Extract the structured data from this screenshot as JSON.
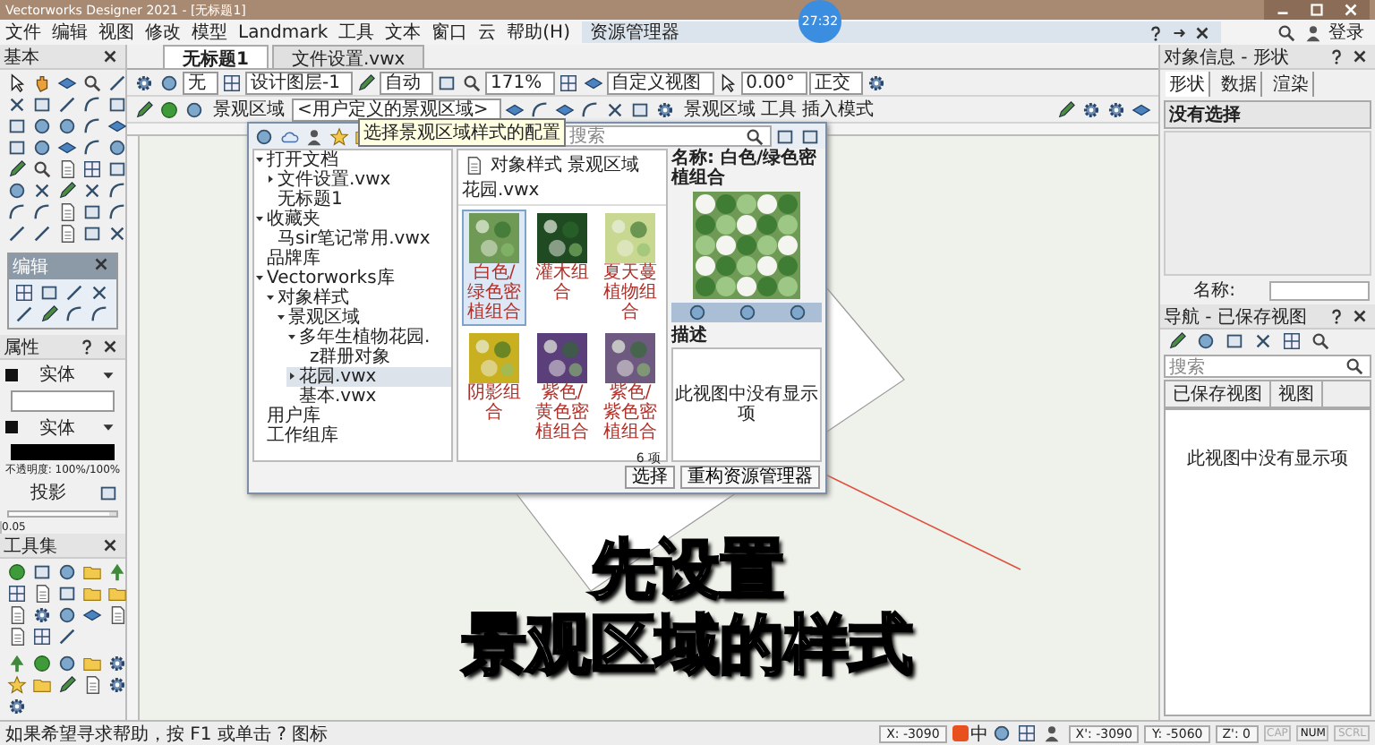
{
  "window": {
    "title": "Vectorworks Designer 2021 - [无标题1]"
  },
  "timer": "27:32",
  "menu": [
    "文件",
    "编辑",
    "视图",
    "修改",
    "模型",
    "Landmark",
    "工具",
    "文本",
    "窗口",
    "云",
    "帮助(H)"
  ],
  "account": {
    "label": "登录"
  },
  "document_tabs": [
    {
      "label": "无标题1",
      "selected": true
    },
    {
      "label": "文件设置.vwx",
      "selected": false
    }
  ],
  "tool_palette": {
    "title": "基本"
  },
  "edit_palette": {
    "title": "编辑"
  },
  "attributes": {
    "title": "属性",
    "fill_style": "实体",
    "pen_style": "实体",
    "opacity": "不透明度: 100%/100%",
    "shadow": "投影",
    "thickness": "0.05",
    "level": 0.93
  },
  "toolsets": {
    "title": "工具集"
  },
  "view_bar": {
    "class": "无",
    "layer": "设计图层-1",
    "scale": "自动",
    "zoom": "171%",
    "view": "自定义视图",
    "rotation": "0.00°",
    "projection": "正交"
  },
  "mode_bar": {
    "style_label": "景观区域",
    "style_value": "<用户定义的景观区域>",
    "mode_label": "景观区域 工具 插入模式",
    "tooltip": "选择景观区域样式的配置"
  },
  "resource_manager": {
    "title": "资源管理器",
    "search_placeholder": "搜索",
    "tree": [
      {
        "label": "打开文档",
        "expanded": true,
        "children": [
          {
            "label": "文件设置.vwx",
            "expanded": false,
            "selected": false
          },
          {
            "label": "无标题1",
            "selected": false
          }
        ]
      },
      {
        "label": "收藏夹",
        "expanded": true,
        "children": [
          {
            "label": "马sir笔记常用.vwx",
            "selected": false
          }
        ]
      },
      {
        "label": "品牌库",
        "selected": false
      },
      {
        "label": "Vectorworks库",
        "expanded": true,
        "children": [
          {
            "label": "对象样式",
            "expanded": true,
            "children": [
              {
                "label": "景观区域",
                "expanded": true,
                "children": [
                  {
                    "label": "多年生植物花园.",
                    "expanded": true,
                    "children": [
                      {
                        "label": "z群册对象",
                        "selected": false
                      }
                    ]
                  },
                  {
                    "label": "花园.vwx",
                    "expanded": false,
                    "selected": true
                  },
                  {
                    "label": "基本.vwx",
                    "selected": false
                  }
                ]
              }
            ]
          }
        ]
      },
      {
        "label": "用户库",
        "selected": false
      },
      {
        "label": "工作组库",
        "selected": false
      }
    ],
    "breadcrumb": [
      "对象样式",
      "景观区域",
      "花园.vwx"
    ],
    "resources": [
      {
        "name": "白色/绿色密植组合",
        "color": "#6f9a55",
        "selected": true
      },
      {
        "name": "灌木组合",
        "color": "#1f4a22",
        "selected": false
      },
      {
        "name": "夏天蔓植物组合",
        "color": "#c8d890",
        "selected": false
      },
      {
        "name": "阴影组合",
        "color": "#c9b020",
        "selected": false
      },
      {
        "name": "紫色/黄色密植组合",
        "color": "#5a3f7a",
        "selected": false
      },
      {
        "name": "紫色/紫色密植组合",
        "color": "#6e5a80",
        "selected": false
      }
    ],
    "count": "6 项",
    "preview_name": "名称: 白色/绿色密植组合",
    "description_label": "描述",
    "description_empty": "此视图中没有显示项",
    "buttons": [
      "选择",
      "重构资源管理器"
    ]
  },
  "object_info": {
    "title": "对象信息 - 形状",
    "tabs": [
      {
        "label": "形状",
        "selected": true
      },
      {
        "label": "数据",
        "selected": false
      },
      {
        "label": "渲染",
        "selected": false
      }
    ],
    "selection": "没有选择",
    "name_label": "名称:"
  },
  "navigation": {
    "title": "导航 - 已保存视图",
    "search_placeholder": "搜索",
    "columns": [
      "已保存视图",
      "视图"
    ],
    "empty": "此视图中没有显示项"
  },
  "status_bar": {
    "help": "如果希望寻求帮助，按 F1 或单击 ? 图标",
    "ime": "中",
    "coords": [
      "X: -3090",
      "X': -3090",
      "Y: -5060",
      "Z': 0"
    ],
    "flags": [
      {
        "label": "CAP",
        "on": false
      },
      {
        "label": "NUM",
        "on": true
      },
      {
        "label": "SCRL",
        "on": false
      }
    ]
  },
  "subtitle": [
    "先设置",
    "景观区域的样式"
  ]
}
